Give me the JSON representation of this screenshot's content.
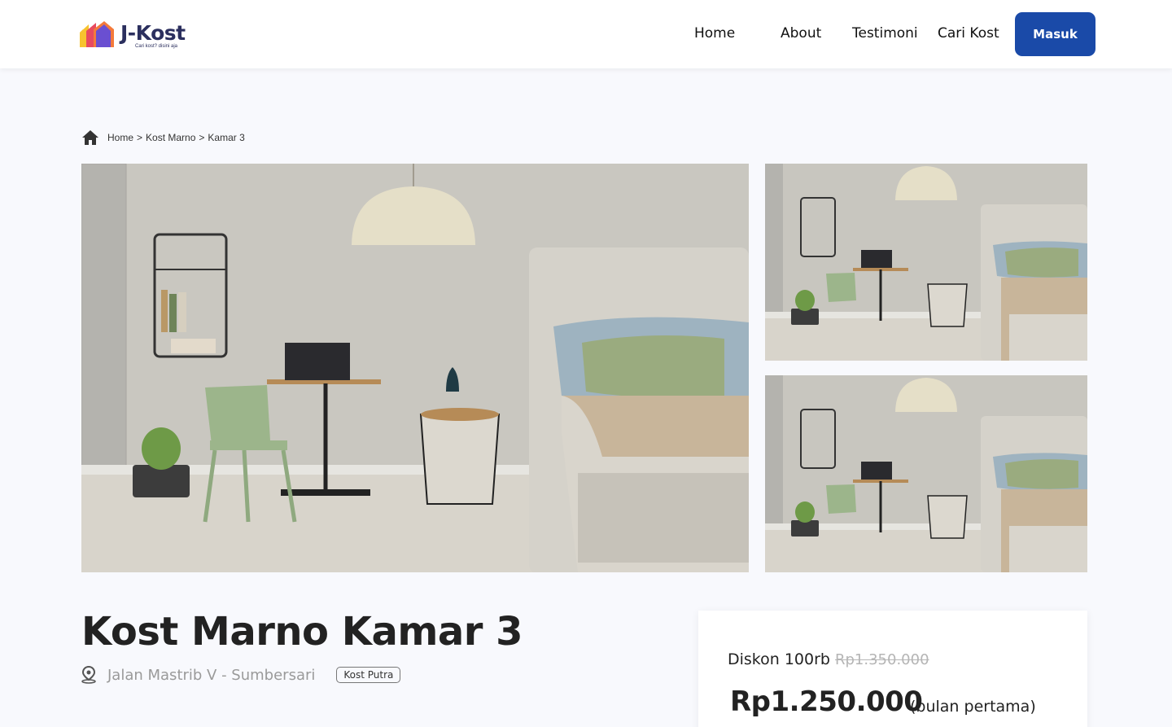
{
  "brand": {
    "name": "J-Kost",
    "tagline": "Cari kost? disini aja"
  },
  "nav": {
    "home": "Home",
    "about": "About",
    "testimoni": "Testimoni",
    "cari_kost": "Cari Kost",
    "login_button": "Masuk"
  },
  "breadcrumb": {
    "items": [
      "Home",
      "Kost Marno",
      "Kamar 3"
    ],
    "separator": ">"
  },
  "listing": {
    "title": "Kost Marno Kamar 3",
    "location": "Jalan Mastrib V - Sumbersari",
    "type_tag": "Kost Putra"
  },
  "pricing": {
    "discount_label": "Diskon 100rb",
    "original_price": "Rp1.350.000",
    "price": "Rp1.250.000",
    "price_note": "(bulan pertama)"
  },
  "colors": {
    "primary": "#1a4aa8",
    "brand_text": "#2b2f5e",
    "background": "#f8f9fd"
  }
}
